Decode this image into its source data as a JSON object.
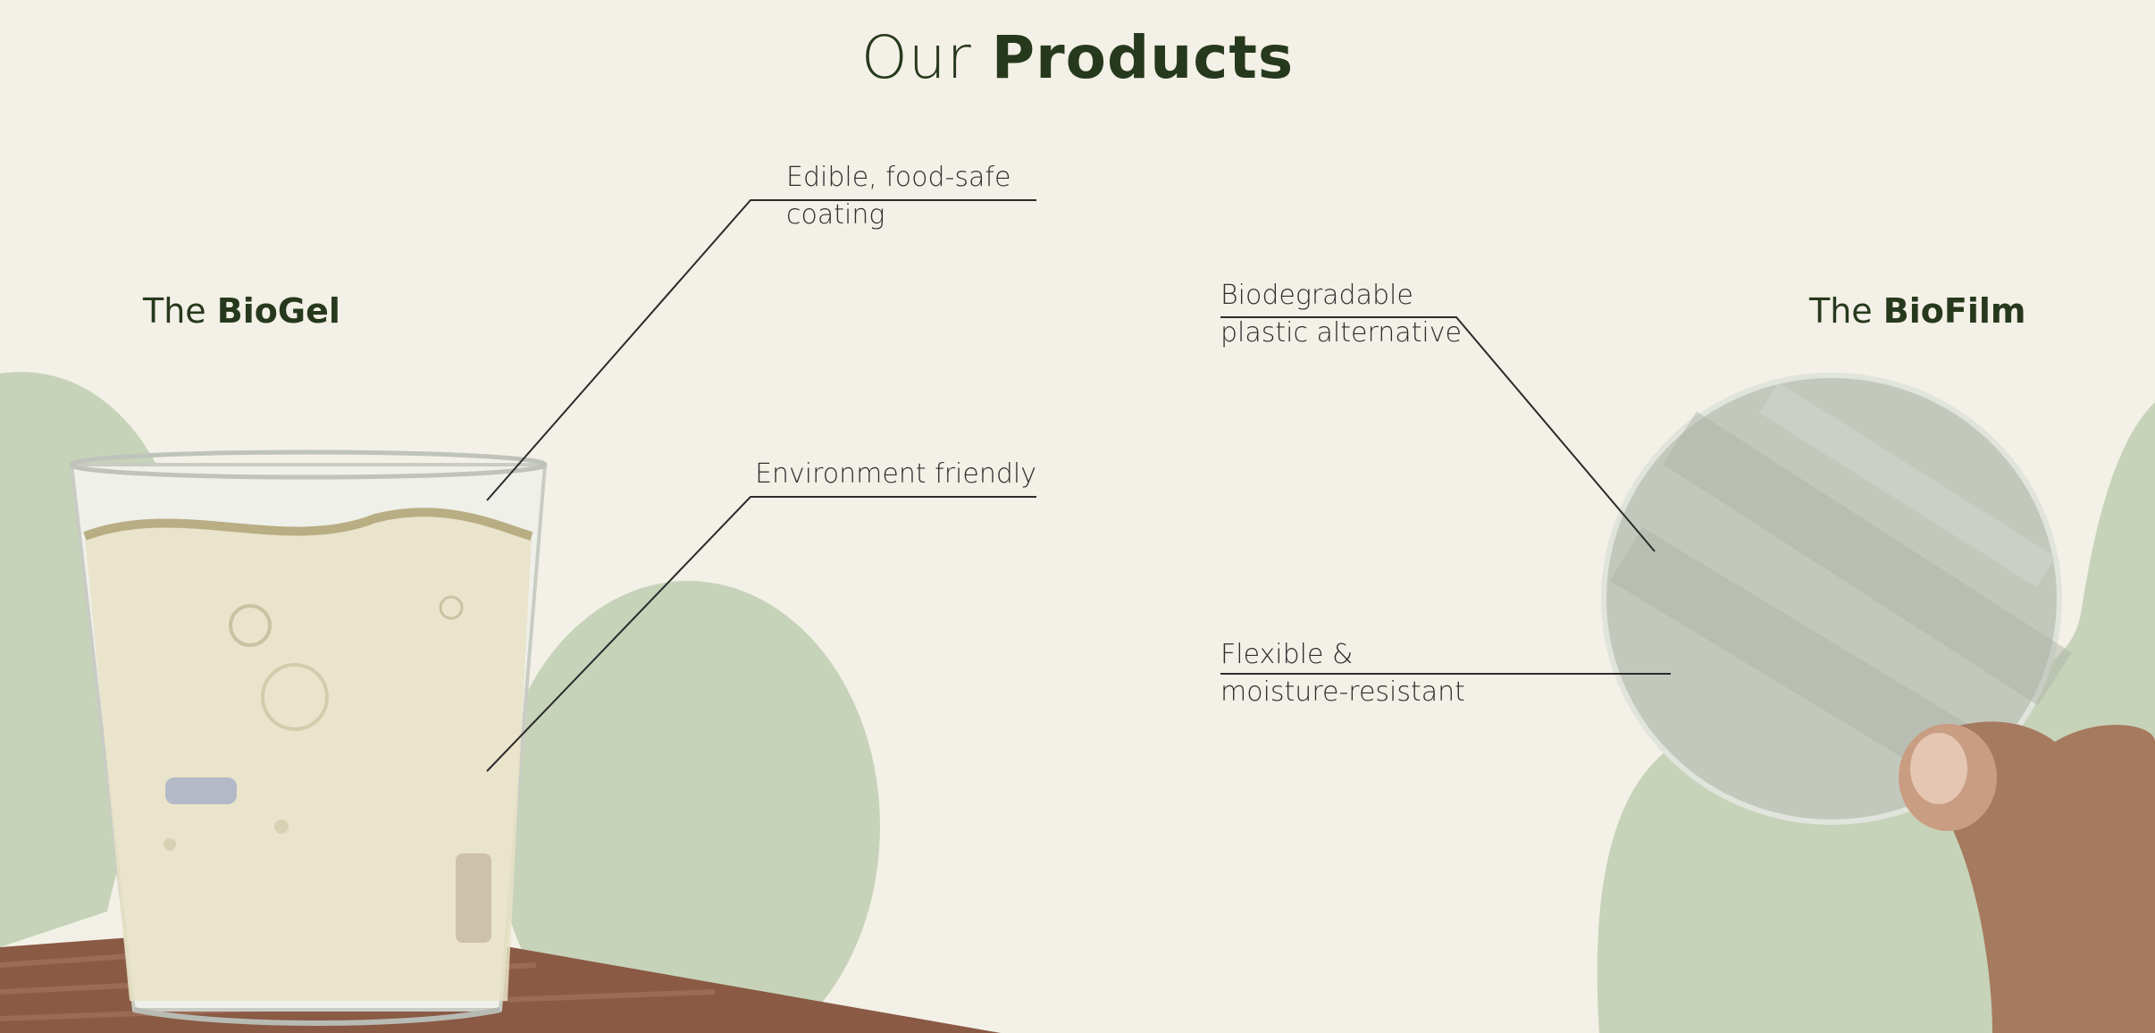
{
  "title": {
    "prefix": "Our",
    "strong": "Products"
  },
  "products": [
    {
      "name_prefix": "The",
      "name_strong": "BioGel",
      "features": [
        "Edible, food-safe coating",
        "Environment friendly"
      ]
    },
    {
      "name_prefix": "The",
      "name_strong": "BioFilm",
      "features": [
        "Biodegradable plastic alternative",
        "Flexible & moisture-resistant"
      ]
    }
  ],
  "colors": {
    "background": "#f3f0e7",
    "blob_green": "#c7d3b9",
    "heading_green": "#27391c",
    "wood": "#8a5a45"
  }
}
